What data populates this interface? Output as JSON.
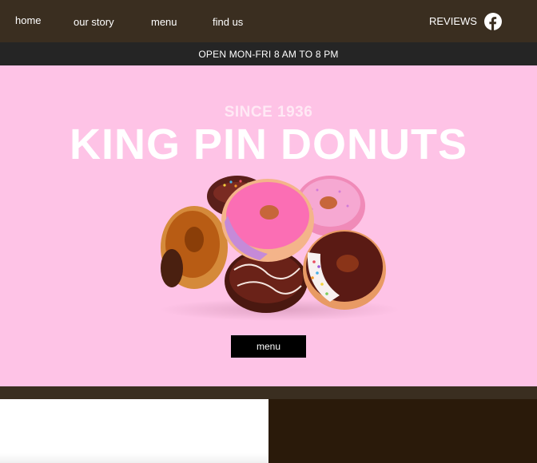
{
  "nav": {
    "home": "home",
    "our_story": "our story",
    "menu": "menu",
    "find_us": "find us",
    "reviews": "REVIEWS",
    "social_icon": "facebook-icon"
  },
  "hours": {
    "text": "OPEN MON-FRI 8 AM TO 8 PM"
  },
  "hero": {
    "since": "SINCE 1936",
    "title": "KING PIN DONUTS",
    "image": "donut-pile-image",
    "button_label": "menu"
  },
  "colors": {
    "nav_bg": "#3a2e20",
    "hours_bg": "#252525",
    "hero_bg": "#fec3e6",
    "button_bg": "#000000",
    "footer_dark": "#2a1a0a"
  }
}
